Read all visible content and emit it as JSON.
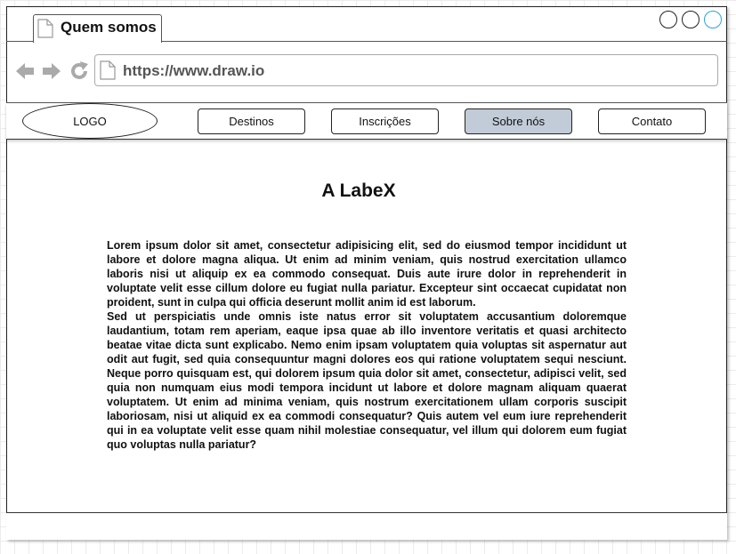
{
  "browser": {
    "tab_title": "Quem somos",
    "url": "https://www.draw.io",
    "icons": [
      "page-icon",
      "back-arrow-icon",
      "forward-arrow-icon",
      "refresh-icon"
    ]
  },
  "nav": {
    "logo": "LOGO",
    "items": [
      {
        "label": "Destinos",
        "active": false
      },
      {
        "label": "Inscrições",
        "active": false
      },
      {
        "label": "Sobre nós",
        "active": true
      },
      {
        "label": "Contato",
        "active": false
      }
    ]
  },
  "content": {
    "title": "A LabeX",
    "paragraphs": [
      "Lorem ipsum dolor sit amet, consectetur adipisicing elit, sed do eiusmod tempor incididunt ut labore et dolore magna aliqua. Ut enim ad minim veniam, quis nostrud exercitation ullamco laboris nisi ut aliquip ex ea commodo consequat. Duis aute irure dolor in reprehenderit in voluptate velit esse cillum dolore eu fugiat nulla pariatur. Excepteur sint occaecat cupidatat non proident, sunt in culpa qui officia deserunt mollit anim id est laborum.",
      "Sed ut perspiciatis unde omnis iste natus error sit voluptatem accusantium doloremque laudantium, totam rem aperiam, eaque ipsa quae ab illo inventore veritatis et quasi architecto beatae vitae dicta sunt explicabo. Nemo enim ipsam voluptatem quia voluptas sit aspernatur aut odit aut fugit, sed quia consequuntur magni dolores eos qui ratione voluptatem sequi nesciunt. Neque porro quisquam est, qui dolorem ipsum quia dolor sit amet, consectetur, adipisci velit, sed quia non numquam eius modi tempora incidunt ut labore et dolore magnam aliquam quaerat voluptatem. Ut enim ad minima veniam, quis nostrum exercitationem ullam corporis suscipit laboriosam, nisi ut aliquid ex ea commodi consequatur? Quis autem vel eum iure reprehenderit qui in ea voluptate velit esse quam nihil molestiae consequatur, vel illum qui dolorem eum fugiat quo voluptas nulla pariatur?"
    ]
  },
  "colors": {
    "active_nav": "#c2ccd8",
    "maximize_button_border": "#29a3d9"
  }
}
